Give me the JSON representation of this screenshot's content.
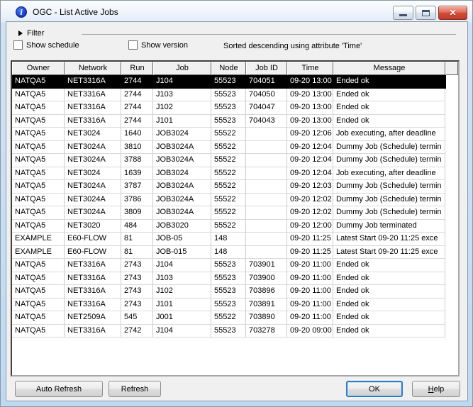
{
  "window": {
    "title": "OGC - List Active Jobs",
    "controls": {
      "minimize": "minimize",
      "maximize": "maximize",
      "close": "close"
    },
    "close_glyph": "✕"
  },
  "filter": {
    "label": "Filter"
  },
  "options": {
    "show_schedule": "Show schedule",
    "show_version": "Show version",
    "sort_note": "Sorted descending using attribute 'Time'"
  },
  "table": {
    "columns": [
      "Owner",
      "Network",
      "Run",
      "Job",
      "Node",
      "Job ID",
      "Time",
      "Message"
    ],
    "selected_row_index": 0,
    "rows": [
      [
        "NATQA5",
        "NET3316A",
        "2744",
        "J104",
        "55523",
        "704051",
        "09-20 13:00",
        "Ended ok"
      ],
      [
        "NATQA5",
        "NET3316A",
        "2744",
        "J103",
        "55523",
        "704050",
        "09-20 13:00",
        "Ended ok"
      ],
      [
        "NATQA5",
        "NET3316A",
        "2744",
        "J102",
        "55523",
        "704047",
        "09-20 13:00",
        "Ended ok"
      ],
      [
        "NATQA5",
        "NET3316A",
        "2744",
        "J101",
        "55523",
        "704043",
        "09-20 13:00",
        "Ended ok"
      ],
      [
        "NATQA5",
        "NET3024",
        "1640",
        "JOB3024",
        "55522",
        "",
        "09-20 12:06",
        "Job executing, after deadline"
      ],
      [
        "NATQA5",
        "NET3024A",
        "3810",
        "JOB3024A",
        "55522",
        "",
        "09-20 12:04",
        "Dummy Job (Schedule) termin"
      ],
      [
        "NATQA5",
        "NET3024A",
        "3788",
        "JOB3024A",
        "55522",
        "",
        "09-20 12:04",
        "Dummy Job (Schedule) termin"
      ],
      [
        "NATQA5",
        "NET3024",
        "1639",
        "JOB3024",
        "55522",
        "",
        "09-20 12:04",
        "Job executing, after deadline"
      ],
      [
        "NATQA5",
        "NET3024A",
        "3787",
        "JOB3024A",
        "55522",
        "",
        "09-20 12:03",
        "Dummy Job (Schedule) termin"
      ],
      [
        "NATQA5",
        "NET3024A",
        "3786",
        "JOB3024A",
        "55522",
        "",
        "09-20 12:02",
        "Dummy Job (Schedule) termin"
      ],
      [
        "NATQA5",
        "NET3024A",
        "3809",
        "JOB3024A",
        "55522",
        "",
        "09-20 12:02",
        "Dummy Job (Schedule) termin"
      ],
      [
        "NATQA5",
        "NET3020",
        "484",
        "JOB3020",
        "55522",
        "",
        "09-20 12:00",
        "Dummy Job terminated"
      ],
      [
        "EXAMPLE",
        "E60-FLOW",
        "81",
        "JOB-05",
        "148",
        "",
        "09-20 11:25",
        "Latest Start 09-20 11:25 exce"
      ],
      [
        "EXAMPLE",
        "E60-FLOW",
        "81",
        "JOB-015",
        "148",
        "",
        "09-20 11:25",
        "Latest Start 09-20 11:25 exce"
      ],
      [
        "NATQA5",
        "NET3316A",
        "2743",
        "J104",
        "55523",
        "703901",
        "09-20 11:00",
        "Ended ok"
      ],
      [
        "NATQA5",
        "NET3316A",
        "2743",
        "J103",
        "55523",
        "703900",
        "09-20 11:00",
        "Ended ok"
      ],
      [
        "NATQA5",
        "NET3316A",
        "2743",
        "J102",
        "55523",
        "703896",
        "09-20 11:00",
        "Ended ok"
      ],
      [
        "NATQA5",
        "NET3316A",
        "2743",
        "J101",
        "55523",
        "703891",
        "09-20 11:00",
        "Ended ok"
      ],
      [
        "NATQA5",
        "NET2509A",
        "545",
        "J001",
        "55522",
        "703890",
        "09-20 11:00",
        "Ended ok"
      ],
      [
        "NATQA5",
        "NET3316A",
        "2742",
        "J104",
        "55523",
        "703278",
        "09-20 09:00",
        "Ended ok"
      ]
    ]
  },
  "buttons": {
    "auto_refresh": "Auto Refresh",
    "refresh": "Refresh",
    "ok": "OK",
    "help": "Help"
  },
  "colors": {
    "selection_bg": "#000000",
    "selection_fg": "#ffffff",
    "close_button": "#c0392a",
    "frame": "#bedaf2",
    "default_button_border": "#2b7cc4"
  }
}
